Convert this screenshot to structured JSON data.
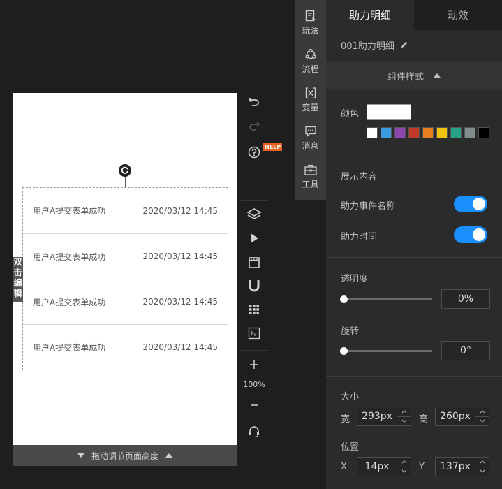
{
  "canvas": {
    "rows": [
      {
        "event": "用户A提交表单成功",
        "time": "2020/03/12 14:45"
      },
      {
        "event": "用户A提交表单成功",
        "time": "2020/03/12 14:45"
      },
      {
        "event": "用户A提交表单成功",
        "time": "2020/03/12 14:45"
      },
      {
        "event": "用户A提交表单成功",
        "time": "2020/03/12 14:45"
      }
    ],
    "edit_tab": "双击编辑",
    "bottom_bar": "拖动调节页面高度"
  },
  "toolbar": {
    "help_badge": "HELP",
    "zoom": "100%"
  },
  "sidenav": {
    "items": [
      {
        "label": "玩法",
        "icon": "gameplay-icon"
      },
      {
        "label": "流程",
        "icon": "flow-icon"
      },
      {
        "label": "变量",
        "icon": "variable-icon"
      },
      {
        "label": "消息",
        "icon": "message-icon"
      },
      {
        "label": "工具",
        "icon": "toolbox-icon"
      }
    ]
  },
  "panel": {
    "tabs": [
      "助力明细",
      "动效"
    ],
    "component_name": "001助力明细",
    "style_header": "组件样式",
    "color_label": "颜色",
    "color_value": "#ffffff",
    "swatches": [
      "#ffffff",
      "#3d9be0",
      "#8e44ad",
      "#c0392b",
      "#e67e22",
      "#f1c40f",
      "#27a085",
      "#7f8c8d",
      "#000000"
    ],
    "display_section": "展示内容",
    "toggles": [
      {
        "label": "助力事件名称",
        "on": true
      },
      {
        "label": "助力时间",
        "on": true
      }
    ],
    "opacity_label": "透明度",
    "opacity_value": "0%",
    "rotate_label": "旋转",
    "rotate_value": "0°",
    "size_label": "大小",
    "width_label": "宽",
    "width_value": "293px",
    "height_label": "高",
    "height_value": "260px",
    "position_label": "位置",
    "x_label": "X",
    "x_value": "14px",
    "y_label": "Y",
    "y_value": "137px"
  }
}
